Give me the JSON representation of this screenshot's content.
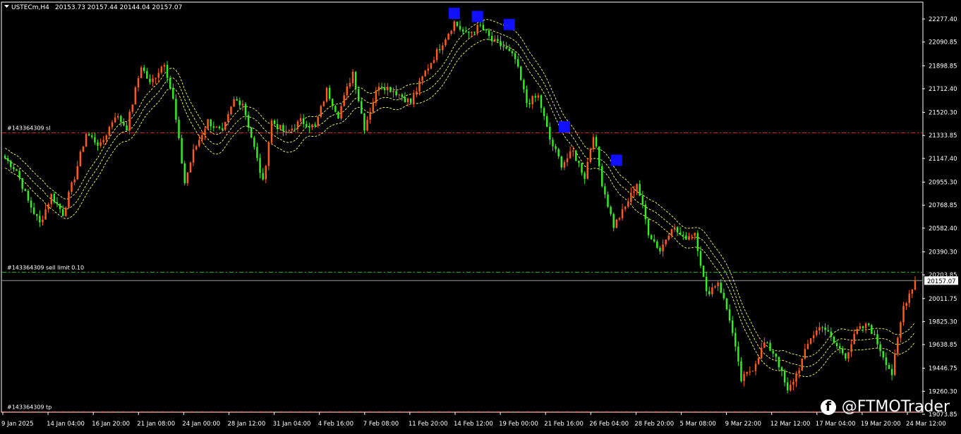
{
  "header": {
    "symbol": "USTECm,H4",
    "ohlc": "20153.73 20157.44 20144.04 20157.07"
  },
  "watermark": {
    "text": "@FTMOTrader",
    "icon": "facebook-icon"
  },
  "colors": {
    "background": "#000000",
    "bull": "#ff5a1f",
    "bear": "#33ee22",
    "envelope": "#ffff66",
    "sl_line": "#d82020",
    "limit_line": "#22c022",
    "tp_line": "#d82020",
    "marker": "#1010ff",
    "axis_text": "#ffffff"
  },
  "chart_data": {
    "type": "candlestick",
    "ylim": [
      19073.85,
      22350
    ],
    "y_ticks": [
      "22277.40",
      "22090.85",
      "21898.85",
      "21712.40",
      "21520.30",
      "21333.85",
      "21147.40",
      "20955.30",
      "20768.85",
      "20582.40",
      "20390.30",
      "20203.85",
      "20011.75",
      "19825.30",
      "19638.85",
      "19446.75",
      "19260.30",
      "19073.85"
    ],
    "x_ticks": [
      "9 Jan 2025",
      "14 Jan 04:00",
      "16 Jan 20:00",
      "21 Jan 08:00",
      "24 Jan 00:00",
      "28 Jan 12:00",
      "31 Jan 04:00",
      "4 Feb 16:00",
      "7 Feb 08:00",
      "11 Feb 20:00",
      "14 Feb 12:00",
      "19 Feb 00:00",
      "21 Feb 16:00",
      "26 Feb 04:00",
      "28 Feb 20:00",
      "5 Mar 08:00",
      "9 Mar 22:00",
      "12 Mar 12:00",
      "17 Mar 04:00",
      "19 Mar 20:00",
      "24 Mar 12:00"
    ],
    "current_price": 20157.07,
    "current_price_label": "20157.07",
    "levels": [
      {
        "label": "#143364309 sl",
        "price": 21355,
        "kind": "sl"
      },
      {
        "label": "#143364309 sell limit 0.10",
        "price": 20225,
        "kind": "limit"
      },
      {
        "label": "#143364309 tp",
        "price": 19095,
        "kind": "tp"
      }
    ],
    "anchors": [
      [
        0,
        21150
      ],
      [
        4,
        21050
      ],
      [
        8,
        20800
      ],
      [
        12,
        20620
      ],
      [
        16,
        20850
      ],
      [
        20,
        20700
      ],
      [
        24,
        21000
      ],
      [
        28,
        21350
      ],
      [
        33,
        21250
      ],
      [
        38,
        21500
      ],
      [
        42,
        21400
      ],
      [
        47,
        21900
      ],
      [
        50,
        21750
      ],
      [
        55,
        21930
      ],
      [
        58,
        21620
      ],
      [
        62,
        20950
      ],
      [
        65,
        21200
      ],
      [
        70,
        21450
      ],
      [
        75,
        21350
      ],
      [
        79,
        21620
      ],
      [
        82,
        21600
      ],
      [
        86,
        21230
      ],
      [
        89,
        20950
      ],
      [
        92,
        21450
      ],
      [
        97,
        21350
      ],
      [
        102,
        21450
      ],
      [
        107,
        21400
      ],
      [
        111,
        21700
      ],
      [
        115,
        21500
      ],
      [
        120,
        21850
      ],
      [
        124,
        21400
      ],
      [
        129,
        21750
      ],
      [
        134,
        21700
      ],
      [
        140,
        21600
      ],
      [
        145,
        21850
      ],
      [
        150,
        22050
      ],
      [
        155,
        22250
      ],
      [
        159,
        22150
      ],
      [
        164,
        22220
      ],
      [
        168,
        22100
      ],
      [
        172,
        22050
      ],
      [
        176,
        21950
      ],
      [
        180,
        21600
      ],
      [
        184,
        21650
      ],
      [
        188,
        21300
      ],
      [
        192,
        21100
      ],
      [
        196,
        21200
      ],
      [
        200,
        21000
      ],
      [
        203,
        21350
      ],
      [
        206,
        20950
      ],
      [
        210,
        20600
      ],
      [
        214,
        20750
      ],
      [
        218,
        20950
      ],
      [
        222,
        20550
      ],
      [
        226,
        20400
      ],
      [
        230,
        20600
      ],
      [
        234,
        20500
      ],
      [
        238,
        20550
      ],
      [
        242,
        20050
      ],
      [
        246,
        20150
      ],
      [
        250,
        19850
      ],
      [
        254,
        19350
      ],
      [
        258,
        19450
      ],
      [
        262,
        19650
      ],
      [
        266,
        19550
      ],
      [
        270,
        19250
      ],
      [
        274,
        19450
      ],
      [
        278,
        19700
      ],
      [
        282,
        19800
      ],
      [
        286,
        19650
      ],
      [
        290,
        19550
      ],
      [
        294,
        19750
      ],
      [
        298,
        19800
      ],
      [
        302,
        19600
      ],
      [
        306,
        19400
      ],
      [
        310,
        19950
      ],
      [
        314,
        20157
      ]
    ],
    "candle_count": 315,
    "markers": [
      {
        "index": 155,
        "price": 22300
      },
      {
        "index": 163,
        "price": 22275
      },
      {
        "index": 174,
        "price": 22210
      },
      {
        "index": 193,
        "price": 21380
      },
      {
        "index": 211,
        "price": 21110
      }
    ]
  }
}
